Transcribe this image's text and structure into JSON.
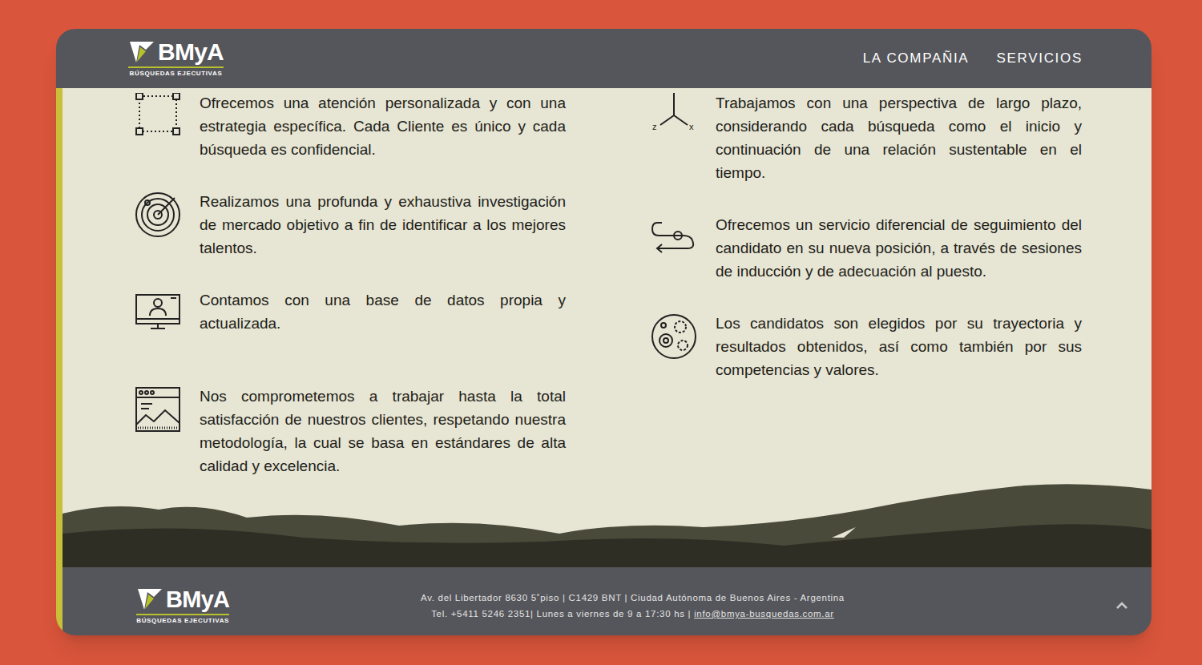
{
  "logo": {
    "mark": "BMyA",
    "tagline": "BÚSQUEDAS EJECUTIVAS"
  },
  "nav": [
    {
      "label": "LA COMPAÑIA",
      "selected": false
    },
    {
      "label": "SERVICIOS",
      "selected": false
    }
  ],
  "features_left": [
    {
      "text": "Ofrecemos una atención personalizada y con una estrategia específica. Cada Cliente es único y cada búsqueda es confidencial."
    },
    {
      "text": "Realizamos una profunda y exhaustiva investigación de mercado objetivo a fin de identificar a los mejores talentos."
    },
    {
      "text": "Contamos con una base de datos propia y actualizada."
    },
    {
      "text": "Nos comprometemos a trabajar hasta la total satisfacción de nuestros clientes, respetando nuestra metodología, la cual se basa en estándares de alta calidad y excelencia."
    }
  ],
  "features_right": [
    {
      "text": "Trabajamos con una perspectiva de largo plazo, considerando cada búsqueda como el inicio y continuación de una relación sustentable en el tiempo."
    },
    {
      "text": "Ofrecemos un servicio diferencial de seguimiento del candidato en su nueva posición, a través de sesiones de inducción y de adecuación al puesto."
    },
    {
      "text": "Los candidatos son elegidos por su trayectoria y resultados obtenidos, así como también por sus competencias y valores."
    }
  ],
  "axis_icon_labels": [
    "z",
    "x"
  ],
  "footer": {
    "address": "Av. del Libertador 8630 5˚piso | C1429 BNT | Ciudad Autónoma de Buenos Aires - Argentina",
    "phone": "Tel. +5411 5246 2351| Lunes a viernes de 9 a 17:30 hs | ",
    "email": "info@bmya-busquedas.com.ar"
  }
}
